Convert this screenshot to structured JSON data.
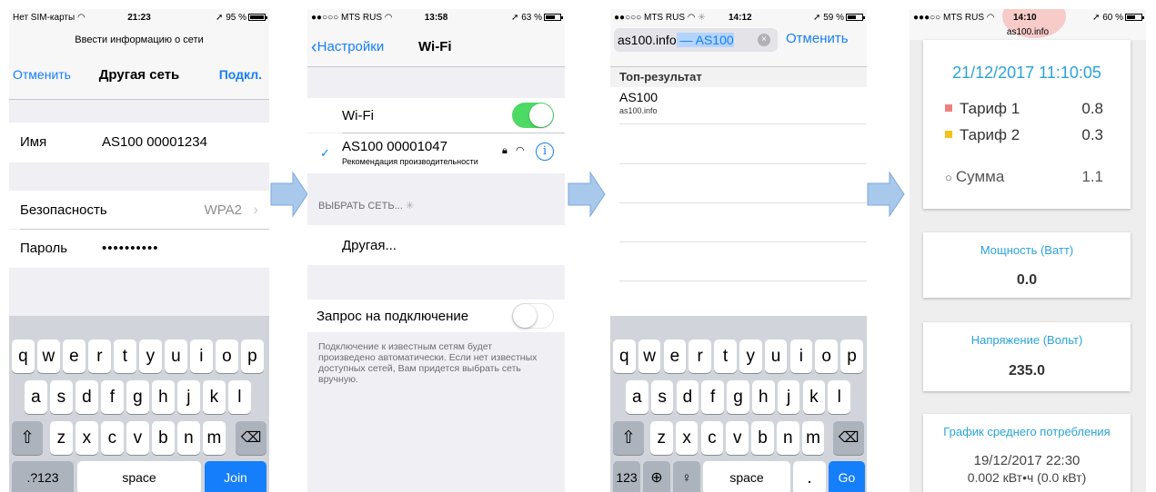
{
  "screen1": {
    "status": {
      "carrier": "Нет SIM-карты",
      "time": "21:23",
      "battery": "95 %"
    },
    "header_caption": "Ввести информацию о сети",
    "cancel": "Отменить",
    "title": "Другая сеть",
    "connect": "Подкл.",
    "name_label": "Имя",
    "name_value": "AS100 00001234",
    "security_label": "Безопасность",
    "security_value": "WPA2",
    "password_label": "Пароль",
    "password_value": "••••••••••",
    "keys_row1": [
      "q",
      "w",
      "e",
      "r",
      "t",
      "y",
      "u",
      "i",
      "o",
      "p"
    ],
    "keys_row2": [
      "a",
      "s",
      "d",
      "f",
      "g",
      "h",
      "j",
      "k",
      "l"
    ],
    "keys_row3": [
      "z",
      "x",
      "c",
      "v",
      "b",
      "n",
      "m"
    ],
    "key_numbers": ".?123",
    "key_space": "space",
    "key_join": "Join"
  },
  "screen2": {
    "status": {
      "carrier": "MTS RUS",
      "time": "13:58",
      "battery": "63 %"
    },
    "back": "Настройки",
    "title": "Wi-Fi",
    "wifi_label": "Wi-Fi",
    "network_name": "AS100 00001047",
    "network_note": "Рекомендация производительности",
    "choose_header": "ВЫБРАТЬ СЕТЬ...",
    "other": "Другая...",
    "ask_join": "Запрос на подключение",
    "ask_join_note": "Подключение к известным сетям будет произведено автоматически. Если нет известных доступных сетей, Вам придется выбрать сеть вручную."
  },
  "screen3": {
    "status": {
      "carrier": "MTS RUS",
      "time": "14:12",
      "battery": "59 %"
    },
    "search_typed": "as100.info",
    "search_suggest": " — AS100",
    "cancel": "Отменить",
    "top_header": "Топ-результат",
    "result_title": "AS100",
    "result_url": "as100.info",
    "keys_row1": [
      "q",
      "w",
      "e",
      "r",
      "t",
      "y",
      "u",
      "i",
      "o",
      "p"
    ],
    "keys_row2": [
      "a",
      "s",
      "d",
      "f",
      "g",
      "h",
      "j",
      "k",
      "l"
    ],
    "keys_row3": [
      "z",
      "x",
      "c",
      "v",
      "b",
      "n",
      "m"
    ],
    "key_numbers": "123",
    "key_space": "space",
    "key_dot": ".",
    "key_go": "Go"
  },
  "screen4": {
    "status": {
      "carrier": "MTS RUS",
      "time": "14:10",
      "url": "as100.info",
      "battery": "60 %"
    },
    "datetime": "21/12/2017 11:10:05",
    "tariff1_label": "Тариф 1",
    "tariff1_value": "0.8",
    "tariff2_label": "Тариф 2",
    "tariff2_value": "0.3",
    "sum_label": "Сумма",
    "sum_value": "1.1",
    "power_title": "Мощность (Ватт)",
    "power_value": "0.0",
    "voltage_title": "Напряжение (Вольт)",
    "voltage_value": "235.0",
    "chart_title": "График среднего потребления",
    "chart_date": "19/12/2017 22:30",
    "chart_reading": "0.002 кВт•ч (0.0 кВт)"
  },
  "colors": {
    "ios_blue": "#157efb",
    "switch_green": "#4cd964",
    "accent_teal": "#29a3d9",
    "tariff1": "#f08080",
    "tariff2": "#f5c21b",
    "arrow_fill": "#a8c8ec"
  },
  "battery_levels": {
    "screen1": 0.95,
    "screen2": 0.63,
    "screen3": 0.59,
    "screen4": 0.6
  }
}
